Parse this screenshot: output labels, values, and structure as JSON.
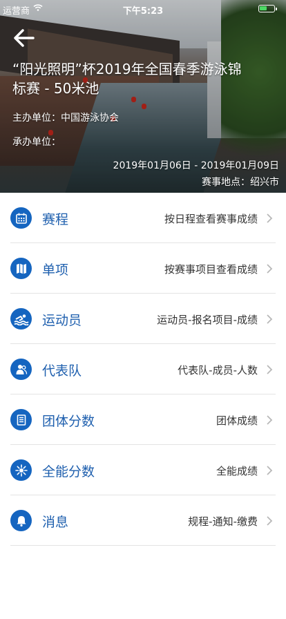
{
  "status_bar": {
    "carrier": "运营商",
    "time": "下午5:23",
    "battery_level": 0.55,
    "battery_color": "#4cd964"
  },
  "header": {
    "back_icon": "back-arrow-icon",
    "title": "“阳光照明”杯2019年全国春季游泳锦标赛 - 50米池",
    "organizer": "主办单位：中国游泳协会",
    "host": "承办单位：",
    "dates": "2019年01月06日 - 2019年01月09日",
    "location": "赛事地点：绍兴市"
  },
  "theme": {
    "accent": "#1565c0",
    "label_color": "#1e5fae"
  },
  "menu": [
    {
      "icon": "calendar-icon",
      "label": "赛程",
      "desc": "按日程查看赛事成绩"
    },
    {
      "icon": "map-icon",
      "label": "单项",
      "desc": "按赛事项目查看成绩"
    },
    {
      "icon": "swimmer-icon",
      "label": "运动员",
      "desc": "运动员-报名项目-成绩"
    },
    {
      "icon": "team-icon",
      "label": "代表队",
      "desc": "代表队-成员-人数"
    },
    {
      "icon": "document-icon",
      "label": "团体分数",
      "desc": "团体成绩"
    },
    {
      "icon": "medal-icon",
      "label": "全能分数",
      "desc": "全能成绩"
    },
    {
      "icon": "bell-icon",
      "label": "消息",
      "desc": "规程-通知-缴费"
    }
  ]
}
